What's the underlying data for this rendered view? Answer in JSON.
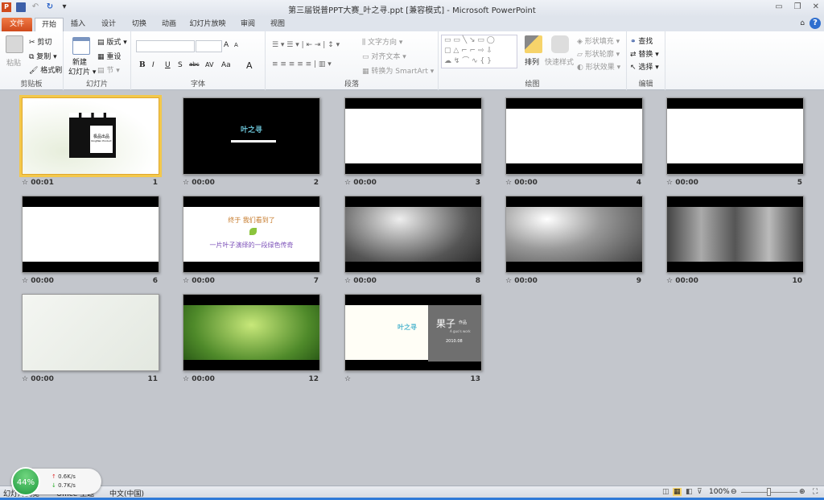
{
  "window": {
    "title": "第三届锐普PPT大赛_叶之寻.ppt [兼容模式] - Microsoft PowerPoint",
    "controls": [
      "minimize",
      "restore",
      "close"
    ]
  },
  "qat": {
    "icons": [
      "powerpoint-logo",
      "save-icon",
      "undo-icon",
      "redo-icon",
      "customize-icon"
    ],
    "logo_text": "P"
  },
  "tabs": [
    "文件",
    "开始",
    "插入",
    "设计",
    "切换",
    "动画",
    "幻灯片放映",
    "审阅",
    "视图"
  ],
  "active_tab": "开始",
  "ribbon": {
    "clipboard": {
      "label": "剪贴板",
      "paste": "粘贴",
      "cut": "剪切",
      "copy": "复制",
      "format_painter": "格式刷"
    },
    "slides": {
      "label": "幻灯片",
      "new_slide_1": "新建",
      "new_slide_2": "幻灯片",
      "layout": "版式",
      "reset": "重设",
      "section": "节"
    },
    "font": {
      "label": "字体",
      "font_name": "",
      "font_size": "",
      "bold": "B",
      "italic": "I",
      "underline": "U",
      "shadow": "S",
      "strike": "abc",
      "spacing": "AV",
      "case": "Aa",
      "grow": "A",
      "shrink": "A",
      "color": "A"
    },
    "paragraph": {
      "label": "段落",
      "text_direction": "文字方向",
      "align_text": "对齐文本",
      "smartart": "转换为 SmartArt"
    },
    "drawing": {
      "label": "绘图",
      "arrange": "排列",
      "quick_styles": "快速样式",
      "shape_fill": "形状填充",
      "shape_outline": "形状轮廓",
      "shape_effects": "形状效果"
    },
    "editing": {
      "label": "编辑",
      "find": "查找",
      "replace": "替换",
      "select": "选择"
    }
  },
  "slides": [
    {
      "num": "1",
      "time": "00:01",
      "kind": "clapper",
      "text": "极品出品",
      "subtext": "KingMan Product",
      "selected": true
    },
    {
      "num": "2",
      "time": "00:00",
      "kind": "black-title",
      "text": "叶之寻"
    },
    {
      "num": "3",
      "time": "00:00",
      "kind": "blank"
    },
    {
      "num": "4",
      "time": "00:00",
      "kind": "blank"
    },
    {
      "num": "5",
      "time": "00:00",
      "kind": "blank"
    },
    {
      "num": "6",
      "time": "00:00",
      "kind": "blank"
    },
    {
      "num": "7",
      "time": "00:00",
      "kind": "text",
      "line1": "终于 我们看到了",
      "line2": "一片叶子演绎的一段绿色传奇"
    },
    {
      "num": "8",
      "time": "00:00",
      "kind": "forest-gray"
    },
    {
      "num": "9",
      "time": "00:00",
      "kind": "forest-leaf"
    },
    {
      "num": "10",
      "time": "00:00",
      "kind": "forest-gray2"
    },
    {
      "num": "11",
      "time": "00:00",
      "kind": "faded"
    },
    {
      "num": "12",
      "time": "00:00",
      "kind": "tree-green"
    },
    {
      "num": "13",
      "time": "",
      "kind": "credits",
      "title": "叶之寻",
      "author": "果子",
      "author_sub": "作品",
      "author_en": "A guo's work",
      "date": "2010.08"
    }
  ],
  "statusbar": {
    "view": "幻灯片浏览",
    "theme": "Office 主题",
    "language": "中文(中国)",
    "zoom": "100%",
    "zoom_level": 100
  },
  "network_widget": {
    "percent": "44%",
    "up": "0.6K/s",
    "down": "0.7K/s"
  },
  "colors": {
    "file_tab": "#d04a1c",
    "selection": "#f3c84b",
    "background": "#c3c6cc"
  }
}
